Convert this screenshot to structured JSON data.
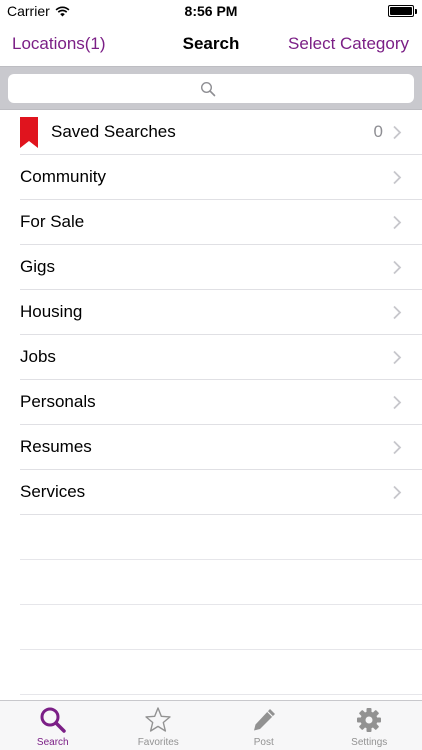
{
  "status_bar": {
    "carrier": "Carrier",
    "time": "8:56 PM"
  },
  "nav": {
    "left_label": "Locations(1)",
    "title": "Search",
    "right_label": "Select Category"
  },
  "search": {
    "placeholder": ""
  },
  "saved_searches": {
    "label": "Saved Searches",
    "count": "0"
  },
  "categories": [
    {
      "label": "Community"
    },
    {
      "label": "For Sale"
    },
    {
      "label": "Gigs"
    },
    {
      "label": "Housing"
    },
    {
      "label": "Jobs"
    },
    {
      "label": "Personals"
    },
    {
      "label": "Resumes"
    },
    {
      "label": "Services"
    }
  ],
  "tabs": [
    {
      "label": "Search",
      "icon": "search-icon",
      "active": true
    },
    {
      "label": "Favorites",
      "icon": "star-icon",
      "active": false
    },
    {
      "label": "Post",
      "icon": "pencil-icon",
      "active": false
    },
    {
      "label": "Settings",
      "icon": "gear-icon",
      "active": false
    }
  ],
  "colors": {
    "accent": "#7b1f86",
    "bookmark": "#e0141e",
    "inactive_tab": "#929292"
  }
}
